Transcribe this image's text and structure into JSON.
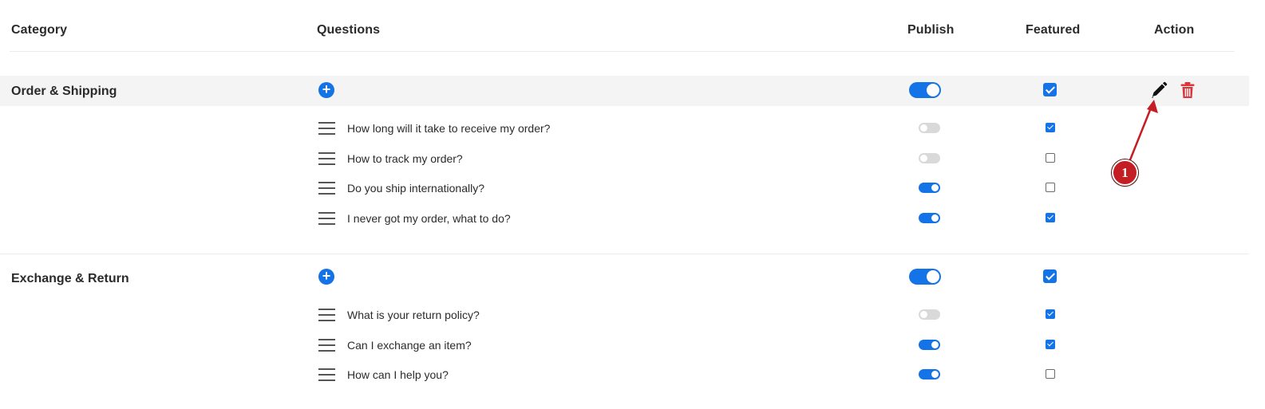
{
  "header": {
    "category": "Category",
    "questions": "Questions",
    "publish": "Publish",
    "featured": "Featured",
    "action": "Action"
  },
  "categories": [
    {
      "name": "Order & Shipping",
      "published": true,
      "featured": true,
      "questions": [
        {
          "text": "How long will it take to receive my order?",
          "published": false,
          "featured": true
        },
        {
          "text": "How to track my order?",
          "published": false,
          "featured": false
        },
        {
          "text": "Do you ship internationally?",
          "published": true,
          "featured": false
        },
        {
          "text": "I never got my order, what to do?",
          "published": true,
          "featured": true
        }
      ]
    },
    {
      "name": "Exchange & Return",
      "published": true,
      "featured": true,
      "questions": [
        {
          "text": "What is your return policy?",
          "published": false,
          "featured": true
        },
        {
          "text": "Can I exchange an item?",
          "published": true,
          "featured": true
        },
        {
          "text": "How can I help you?",
          "published": true,
          "featured": false
        }
      ]
    }
  ],
  "icons": {
    "add": "plus-circle-icon",
    "drag": "drag-handle-icon",
    "edit": "pencil-icon",
    "delete": "trash-icon"
  },
  "annotation": {
    "label": "1"
  },
  "colors": {
    "accent": "#1473e6",
    "delete": "#d9363e",
    "annotation": "#c41e24"
  }
}
